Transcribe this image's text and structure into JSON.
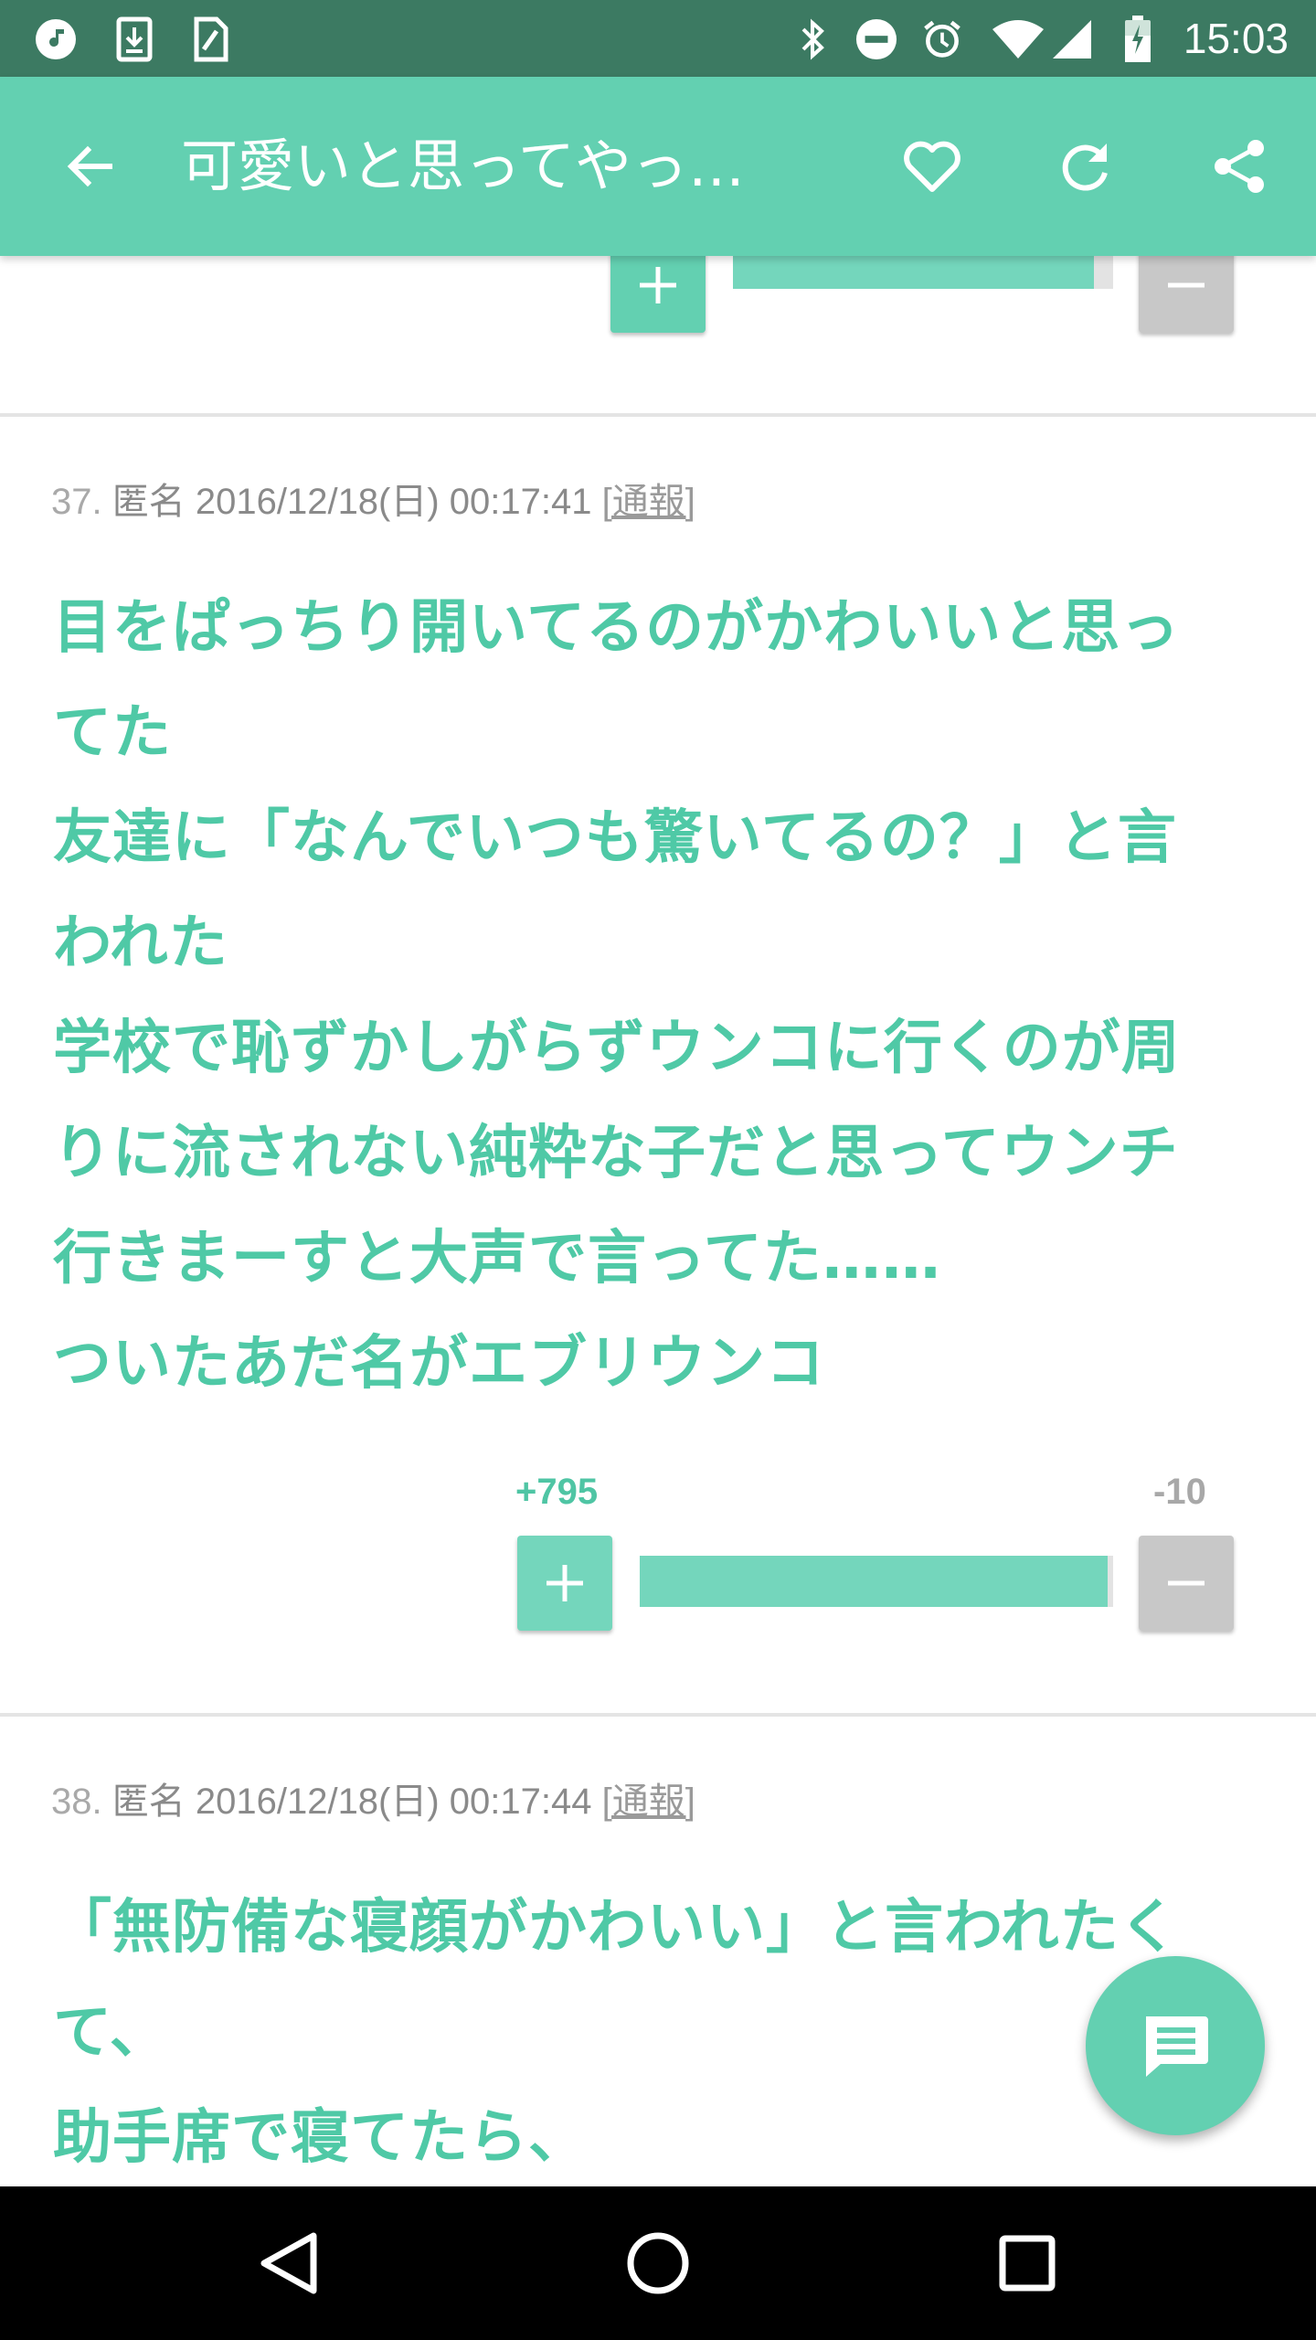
{
  "status_bar": {
    "time": "15:03",
    "left_icons": [
      "music-note-icon",
      "download-icon",
      "sim-card-icon"
    ],
    "right_icons": [
      "bluetooth-icon",
      "do-not-disturb-icon",
      "alarm-icon",
      "wifi-icon",
      "cell-signal-icon",
      "battery-charging-icon"
    ]
  },
  "app_bar": {
    "title": "可愛いと思ってやっ…",
    "back_icon": "arrow-back-icon",
    "actions": [
      "heart-icon",
      "refresh-icon",
      "share-icon"
    ]
  },
  "top_vote": {
    "plus_label": "+",
    "minus_label": "−",
    "ratio": 0.95
  },
  "posts": [
    {
      "number": "37.",
      "author": "匿名",
      "datetime": "2016/12/18(日) 00:17:41",
      "report": "[通報]",
      "lines": [
        "目をぱっちり開いてるのがかわいいと思っ",
        "てた",
        "友達に「なんでいつも驚いてるの？」と言",
        "われた",
        "学校で恥ずかしがらずウンコに行くのが周",
        "りに流されない純粋な子だと思ってウンチ",
        "行きまーすと大声で言ってた……",
        "ついたあだ名がエブリウンコ"
      ],
      "plus_count": "+795",
      "minus_count": "-10",
      "plus_label": "+",
      "minus_label": "−",
      "ratio": 0.988
    },
    {
      "number": "38.",
      "author": "匿名",
      "datetime": "2016/12/18(日) 00:17:44",
      "report": "[通報]",
      "lines": [
        "「無防備な寝顔がかわいい」と言われたく",
        "て、",
        "助手席で寝てたら、"
      ]
    }
  ],
  "fab": {
    "icon": "comment-icon"
  },
  "nav_bar": {
    "buttons": [
      "back-triangle-icon",
      "home-circle-icon",
      "recents-square-icon"
    ]
  },
  "colors": {
    "status_bar": "#3c7a62",
    "accent": "#63d0b1",
    "text_accent": "#4fc9a6",
    "minus_gray": "#c8c8c8"
  }
}
